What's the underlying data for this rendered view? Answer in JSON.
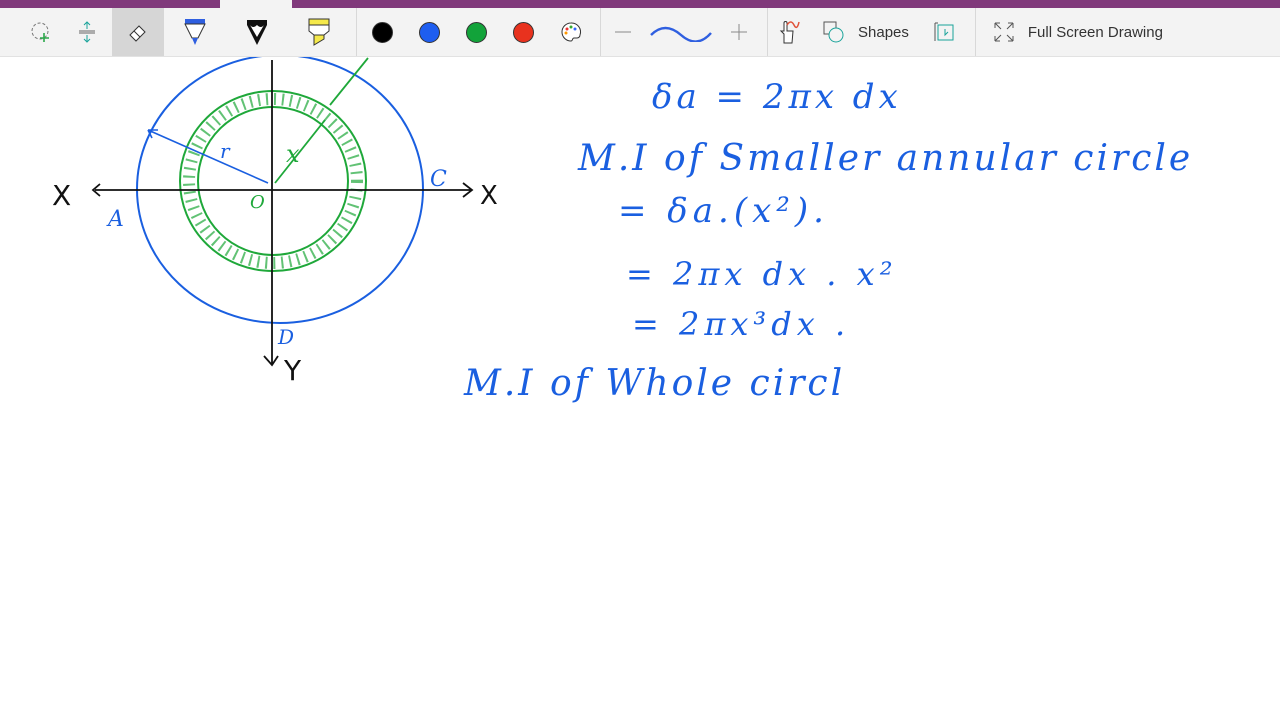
{
  "toolbar": {
    "tools": [
      {
        "name": "lasso-select",
        "icon": "lasso-select-icon"
      },
      {
        "name": "insert-space",
        "icon": "insert-space-icon"
      },
      {
        "name": "eraser",
        "icon": "eraser-icon",
        "selected": true
      },
      {
        "name": "blue-pen",
        "icon": "pen-icon",
        "color": "#2f5fe0"
      },
      {
        "name": "black-pen",
        "icon": "pencil-icon",
        "color": "#111111"
      },
      {
        "name": "highlighter",
        "icon": "highlighter-icon",
        "color": "#f5e94a"
      }
    ],
    "colors": [
      "#000000",
      "#1e5ef0",
      "#12a33a",
      "#e8321e"
    ],
    "color_picker_icon": "palette-icon",
    "thickness_decrease": "minus-icon",
    "thickness_increase": "plus-icon",
    "ink_to_shape_icon": "touch-ink-icon",
    "shapes_label": "Shapes",
    "insert_icon": "insert-page-icon",
    "fullscreen_label": "Full Screen Drawing",
    "accent": "#80397b"
  },
  "canvas": {
    "diagram_labels": {
      "x_left": "X",
      "x_right": "X",
      "y": "Y",
      "a": "A",
      "c": "C",
      "d": "D",
      "o": "O",
      "r": "r",
      "x": "x"
    },
    "notes": [
      "δa = 2πx dx",
      "M.I of Smaller annular circle",
      "= δa.(x²).",
      "= 2πx dx . x²",
      "= 2πx³dx .",
      "M.I of Whole circl"
    ]
  }
}
